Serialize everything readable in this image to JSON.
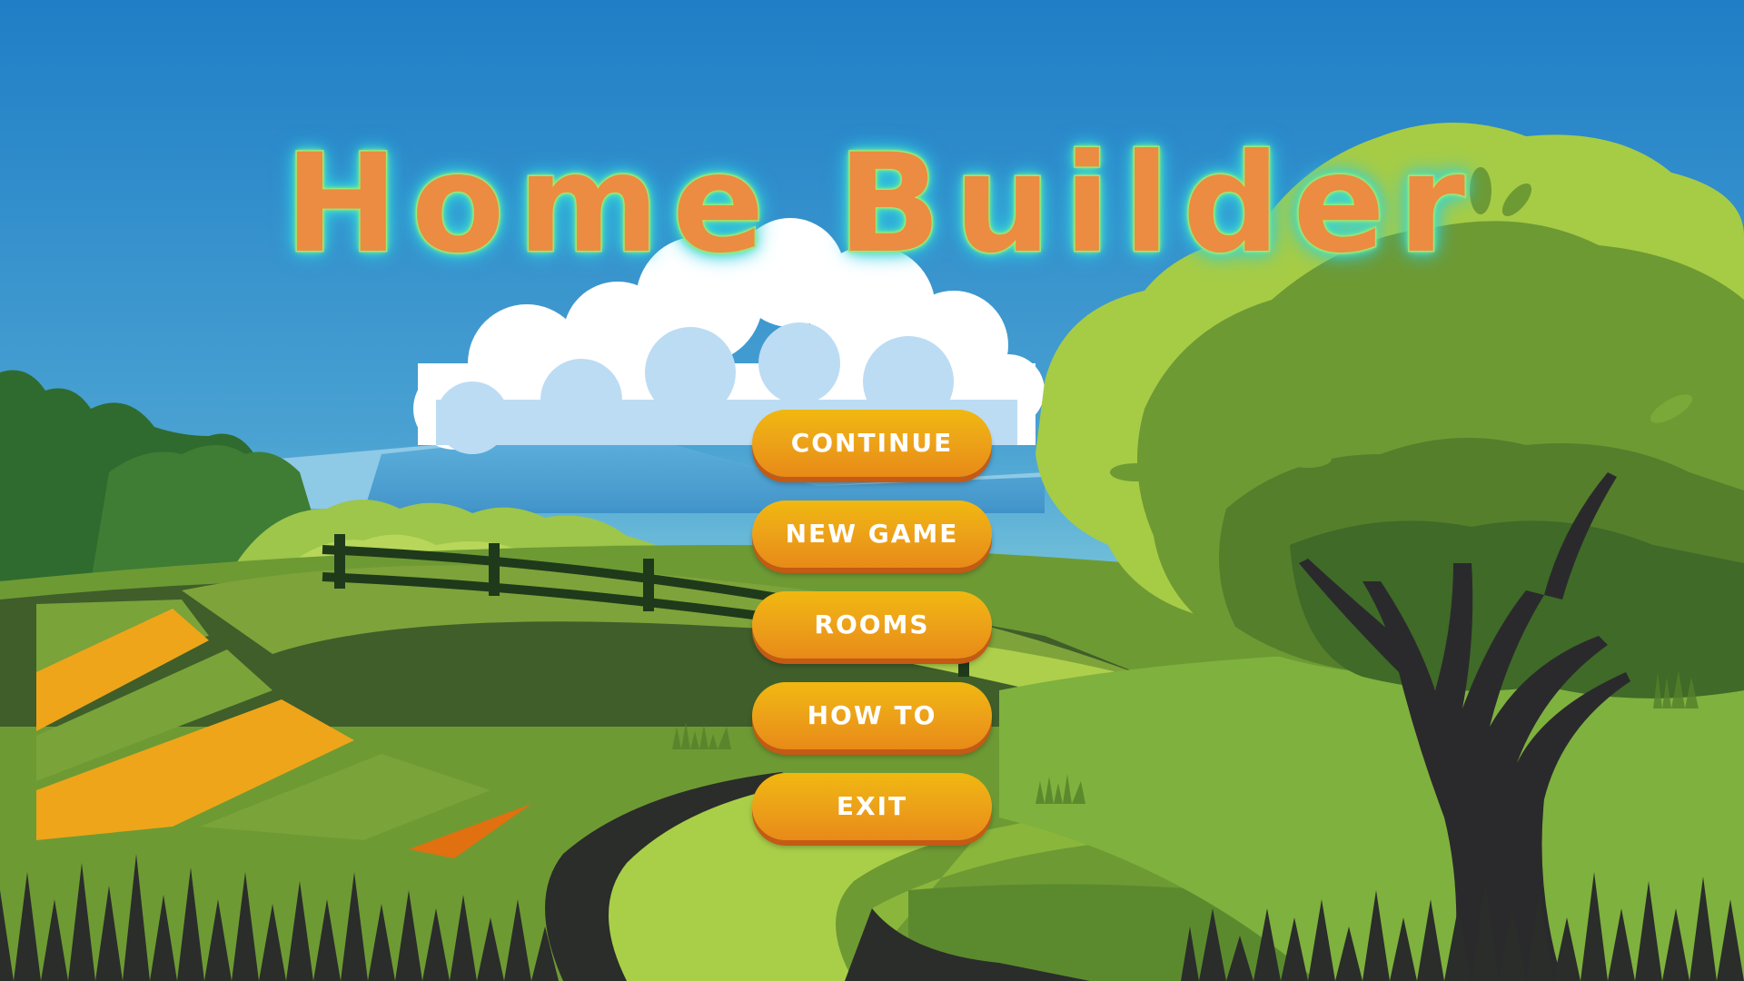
{
  "game": {
    "title": "Home Builder"
  },
  "menu": {
    "items": [
      {
        "id": "continue",
        "label": "CONTINUE"
      },
      {
        "id": "new-game",
        "label": "NEW GAME"
      },
      {
        "id": "rooms",
        "label": "ROOMS"
      },
      {
        "id": "how-to",
        "label": "HOW TO"
      },
      {
        "id": "exit",
        "label": "EXIT"
      }
    ]
  },
  "colors": {
    "sky_top": "#1f7ec6",
    "sky_bottom": "#7cc8dc",
    "button_top": "#f0b810",
    "button_bottom": "#e88a18",
    "title_fill": "#ec8b42",
    "title_glow": "#36d6d6"
  }
}
